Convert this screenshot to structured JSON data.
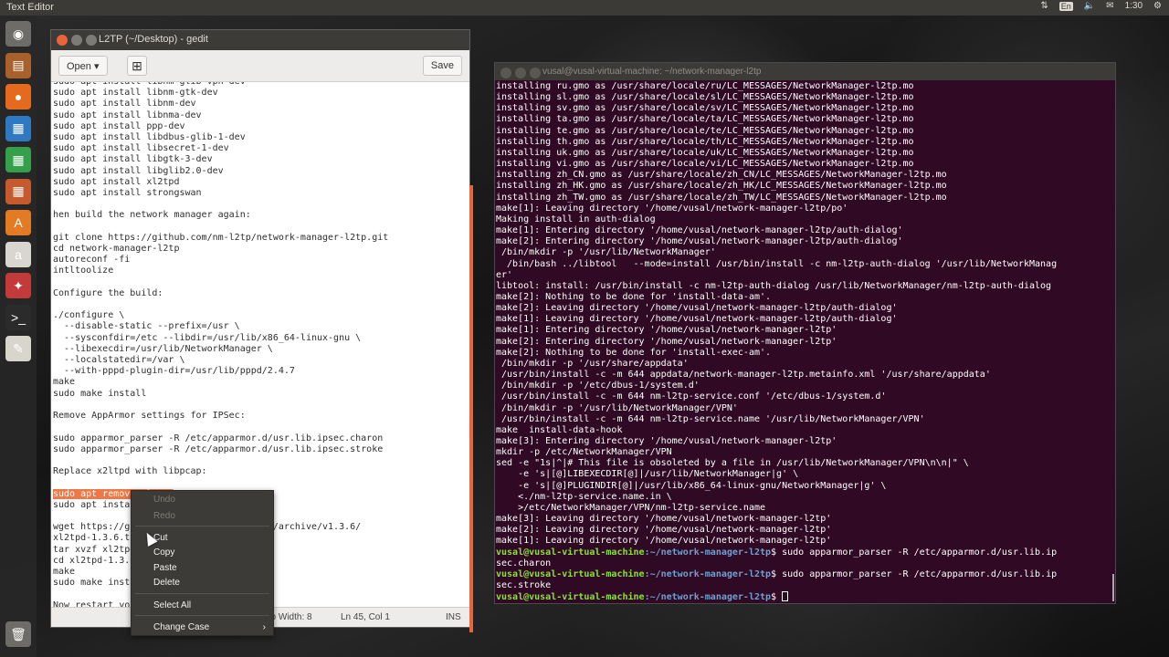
{
  "top_panel": {
    "app_title": "Text Editor",
    "keyboard_layout": "En",
    "clock": "1:30"
  },
  "launcher": {
    "items": [
      {
        "name": "dash-icon",
        "glyph": "◉",
        "color": "#6e6c68"
      },
      {
        "name": "files-icon",
        "glyph": "▤",
        "color": "#a8602c"
      },
      {
        "name": "firefox-icon",
        "glyph": "●",
        "color": "#e56a1e"
      },
      {
        "name": "writer-icon",
        "glyph": "▦",
        "color": "#2f78c2"
      },
      {
        "name": "calc-icon",
        "glyph": "▦",
        "color": "#34a04a"
      },
      {
        "name": "impress-icon",
        "glyph": "▦",
        "color": "#c75a2c"
      },
      {
        "name": "software-center-icon",
        "glyph": "A",
        "color": "#e27b24"
      },
      {
        "name": "amazon-icon",
        "glyph": "a",
        "color": "#d9d6cf"
      },
      {
        "name": "settings-icon",
        "glyph": "✦",
        "color": "#c23a3a"
      },
      {
        "name": "terminal-icon",
        "glyph": ">_",
        "color": "#2b2b2b"
      },
      {
        "name": "text-editor-icon",
        "glyph": "✎",
        "color": "#d8d5cd"
      },
      {
        "name": "trash-icon",
        "glyph": "🗑",
        "color": "#6e6c68"
      }
    ]
  },
  "gedit": {
    "title": "L2TP (~/Desktop) - gedit",
    "open_label": "Open",
    "save_label": "Save",
    "status": {
      "tab_width": "Tab Width: 8",
      "position": "Ln 45, Col 1",
      "mode": "INS"
    },
    "lines": [
      "sudo apt install libnm-glib-vpn-dev",
      "sudo apt install libnm-gtk-dev",
      "sudo apt install libnm-dev",
      "sudo apt install libnma-dev",
      "sudo apt install ppp-dev",
      "sudo apt install libdbus-glib-1-dev",
      "sudo apt install libsecret-1-dev",
      "sudo apt install libgtk-3-dev",
      "sudo apt install libglib2.0-dev",
      "sudo apt install xl2tpd",
      "sudo apt install strongswan",
      "",
      "hen build the network manager again:",
      "",
      "git clone https://github.com/nm-l2tp/network-manager-l2tp.git",
      "cd network-manager-l2tp",
      "autoreconf -fi",
      "intltoolize",
      "",
      "Configure the build:",
      "",
      "./configure \\",
      "  --disable-static --prefix=/usr \\",
      "  --sysconfdir=/etc --libdir=/usr/lib/x86_64-linux-gnu \\",
      "  --libexecdir=/usr/lib/NetworkManager \\",
      "  --localstatedir=/var \\",
      "  --with-pppd-plugin-dir=/usr/lib/pppd/2.4.7",
      "make",
      "sudo make install",
      "",
      "Remove AppArmor settings for IPSec:",
      "",
      "sudo apparmor_parser -R /etc/apparmor.d/usr.lib.ipsec.charon",
      "sudo apparmor_parser -R /etc/apparmor.d/usr.lib.ipsec.stroke",
      "",
      "Replace x2ltpd with libpcap:",
      "",
      "sudo apt remove xl2tpd",
      "sudo apt install libpcap0.8-dev",
      "",
      "wget https://github.com/xelerance/xl2tpd/archive/v1.3.6/",
      "xl2tpd-1.3.6.tar.gz",
      "tar xvzf xl2tpd-1.3.6.tar.gz",
      "cd xl2tpd-1.3.6",
      "make",
      "sudo make install",
      "",
      "Now restart your machine"
    ],
    "selected_line_index": 37
  },
  "context_menu": {
    "items": [
      {
        "label": "Undo",
        "enabled": false
      },
      {
        "label": "Redo",
        "enabled": false
      },
      {
        "label": "Cut",
        "enabled": true
      },
      {
        "label": "Copy",
        "enabled": true
      },
      {
        "label": "Paste",
        "enabled": true
      },
      {
        "label": "Delete",
        "enabled": true
      },
      {
        "label": "Select All",
        "enabled": true
      },
      {
        "label": "Change Case",
        "enabled": true,
        "submenu": true
      }
    ]
  },
  "terminal": {
    "title": "vusal@vusal-virtual-machine: ~/network-manager-l2tp",
    "prompt_user": "vusal@vusal-virtual-machine",
    "prompt_path": ":~/network-manager-l2tp",
    "lines": [
      "installing ru.gmo as /usr/share/locale/ru/LC_MESSAGES/NetworkManager-l2tp.mo",
      "installing sl.gmo as /usr/share/locale/sl/LC_MESSAGES/NetworkManager-l2tp.mo",
      "installing sv.gmo as /usr/share/locale/sv/LC_MESSAGES/NetworkManager-l2tp.mo",
      "installing ta.gmo as /usr/share/locale/ta/LC_MESSAGES/NetworkManager-l2tp.mo",
      "installing te.gmo as /usr/share/locale/te/LC_MESSAGES/NetworkManager-l2tp.mo",
      "installing th.gmo as /usr/share/locale/th/LC_MESSAGES/NetworkManager-l2tp.mo",
      "installing uk.gmo as /usr/share/locale/uk/LC_MESSAGES/NetworkManager-l2tp.mo",
      "installing vi.gmo as /usr/share/locale/vi/LC_MESSAGES/NetworkManager-l2tp.mo",
      "installing zh_CN.gmo as /usr/share/locale/zh_CN/LC_MESSAGES/NetworkManager-l2tp.mo",
      "installing zh_HK.gmo as /usr/share/locale/zh_HK/LC_MESSAGES/NetworkManager-l2tp.mo",
      "installing zh_TW.gmo as /usr/share/locale/zh_TW/LC_MESSAGES/NetworkManager-l2tp.mo",
      "make[1]: Leaving directory '/home/vusal/network-manager-l2tp/po'",
      "Making install in auth-dialog",
      "make[1]: Entering directory '/home/vusal/network-manager-l2tp/auth-dialog'",
      "make[2]: Entering directory '/home/vusal/network-manager-l2tp/auth-dialog'",
      " /bin/mkdir -p '/usr/lib/NetworkManager'",
      "  /bin/bash ../libtool   --mode=install /usr/bin/install -c nm-l2tp-auth-dialog '/usr/lib/NetworkManag",
      "er'",
      "libtool: install: /usr/bin/install -c nm-l2tp-auth-dialog /usr/lib/NetworkManager/nm-l2tp-auth-dialog",
      "make[2]: Nothing to be done for 'install-data-am'.",
      "make[2]: Leaving directory '/home/vusal/network-manager-l2tp/auth-dialog'",
      "make[1]: Leaving directory '/home/vusal/network-manager-l2tp/auth-dialog'",
      "make[1]: Entering directory '/home/vusal/network-manager-l2tp'",
      "make[2]: Entering directory '/home/vusal/network-manager-l2tp'",
      "make[2]: Nothing to be done for 'install-exec-am'.",
      " /bin/mkdir -p '/usr/share/appdata'",
      " /usr/bin/install -c -m 644 appdata/network-manager-l2tp.metainfo.xml '/usr/share/appdata'",
      " /bin/mkdir -p '/etc/dbus-1/system.d'",
      " /usr/bin/install -c -m 644 nm-l2tp-service.conf '/etc/dbus-1/system.d'",
      " /bin/mkdir -p '/usr/lib/NetworkManager/VPN'",
      " /usr/bin/install -c -m 644 nm-l2tp-service.name '/usr/lib/NetworkManager/VPN'",
      "make  install-data-hook",
      "make[3]: Entering directory '/home/vusal/network-manager-l2tp'",
      "mkdir -p /etc/NetworkManager/VPN",
      "sed -e \"1s|^|# This file is obsoleted by a file in /usr/lib/NetworkManager/VPN\\n\\n|\" \\",
      "    -e 's|[@]LIBEXECDIR[@]|/usr/lib/NetworkManager|g' \\",
      "    -e 's|[@]PLUGINDIR[@]|/usr/lib/x86_64-linux-gnu/NetworkManager|g' \\",
      "    <./nm-l2tp-service.name.in \\",
      "    >/etc/NetworkManager/VPN/nm-l2tp-service.name",
      "make[3]: Leaving directory '/home/vusal/network-manager-l2tp'",
      "make[2]: Leaving directory '/home/vusal/network-manager-l2tp'",
      "make[1]: Leaving directory '/home/vusal/network-manager-l2tp'"
    ],
    "commands": [
      {
        "cmd": "$ sudo apparmor_parser -R /etc/apparmor.d/usr.lib.ip",
        "wrap": "sec.charon"
      },
      {
        "cmd": "$ sudo apparmor_parser -R /etc/apparmor.d/usr.lib.ip",
        "wrap": "sec.stroke"
      },
      {
        "cmd": "$ ",
        "wrap": ""
      }
    ]
  }
}
